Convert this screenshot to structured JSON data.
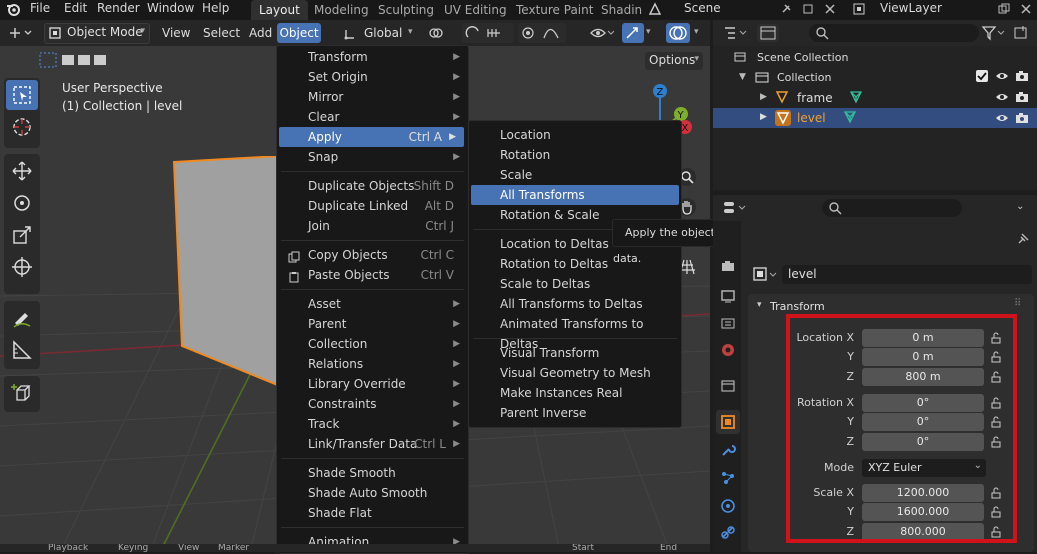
{
  "topmenu": {
    "items": [
      "File",
      "Edit",
      "Render",
      "Window",
      "Help"
    ],
    "workspaces": [
      "Layout",
      "Modeling",
      "Sculpting",
      "UV Editing",
      "Texture Paint",
      "Shadin"
    ],
    "scene": "Scene",
    "view_layer": "ViewLayer"
  },
  "header": {
    "mode": "Object Mode",
    "view": "View",
    "select": "Select",
    "add": "Add",
    "object": "Object",
    "orientation": "Global",
    "options": "Options"
  },
  "viewport": {
    "perspective": "User Perspective",
    "collection": "(1) Collection | level"
  },
  "object_menu": {
    "items": [
      {
        "label": "Transform",
        "shortcut": "",
        "submenu": true
      },
      {
        "label": "Set Origin",
        "shortcut": "",
        "submenu": true
      },
      {
        "label": "Mirror",
        "shortcut": "",
        "submenu": true
      },
      {
        "label": "Clear",
        "shortcut": "",
        "submenu": true
      },
      {
        "label": "Apply",
        "shortcut": "Ctrl A",
        "submenu": true
      },
      {
        "label": "Snap",
        "shortcut": "",
        "submenu": true
      },
      {
        "label": "Duplicate Objects",
        "shortcut": "Shift D",
        "submenu": false
      },
      {
        "label": "Duplicate Linked",
        "shortcut": "Alt D",
        "submenu": false
      },
      {
        "label": "Join",
        "shortcut": "Ctrl J",
        "submenu": false
      },
      {
        "label": "Copy Objects",
        "shortcut": "Ctrl C",
        "submenu": false
      },
      {
        "label": "Paste Objects",
        "shortcut": "Ctrl V",
        "submenu": false
      },
      {
        "label": "Asset",
        "shortcut": "",
        "submenu": true
      },
      {
        "label": "Parent",
        "shortcut": "",
        "submenu": true
      },
      {
        "label": "Collection",
        "shortcut": "",
        "submenu": true
      },
      {
        "label": "Relations",
        "shortcut": "",
        "submenu": true
      },
      {
        "label": "Library Override",
        "shortcut": "",
        "submenu": true
      },
      {
        "label": "Constraints",
        "shortcut": "",
        "submenu": true
      },
      {
        "label": "Track",
        "shortcut": "",
        "submenu": true
      },
      {
        "label": "Link/Transfer Data",
        "shortcut": "Ctrl L",
        "submenu": true
      },
      {
        "label": "Shade Smooth",
        "shortcut": "",
        "submenu": false
      },
      {
        "label": "Shade Auto Smooth",
        "shortcut": "",
        "submenu": false
      },
      {
        "label": "Shade Flat",
        "shortcut": "",
        "submenu": false
      },
      {
        "label": "Animation",
        "shortcut": "",
        "submenu": true
      }
    ],
    "highlighted": "Apply"
  },
  "apply_menu": {
    "items": [
      "Location",
      "Rotation",
      "Scale",
      "All Transforms",
      "Rotation & Scale",
      "Location to Deltas",
      "Rotation to Deltas",
      "Scale to Deltas",
      "All Transforms to Deltas",
      "Animated Transforms to Deltas",
      "Visual Transform",
      "Visual Geometry to Mesh",
      "Make Instances Real",
      "Parent Inverse"
    ],
    "highlighted": "All Transforms"
  },
  "tooltip": "Apply the object's transformation to its data.",
  "outliner": {
    "scene_collection": "Scene Collection",
    "collection": "Collection",
    "objects": [
      "frame",
      "level"
    ],
    "selected": "level"
  },
  "properties": {
    "object_name": "level",
    "panel": "Transform",
    "location": {
      "label": "Location X",
      "x": "0 m",
      "y": "0 m",
      "z": "800 m"
    },
    "rotation": {
      "label": "Rotation X",
      "x": "0°",
      "y": "0°",
      "z": "0°"
    },
    "mode_label": "Mode",
    "mode": "XYZ Euler",
    "scale": {
      "label": "Scale X",
      "x": "1200.000",
      "y": "1600.000",
      "z": "800.000"
    },
    "axis_y": "Y",
    "axis_z": "Z"
  },
  "timeline": {
    "items": [
      "Playback",
      "Keying",
      "View",
      "Marker",
      "Start",
      "End"
    ]
  },
  "colors": {
    "accent": "#4772b3",
    "highlight_red": "#d0121b",
    "selected_text": "#f0a030",
    "gizmo_x": "#d4303c",
    "gizmo_y": "#7fae2a",
    "gizmo_z": "#2f7fd0"
  }
}
